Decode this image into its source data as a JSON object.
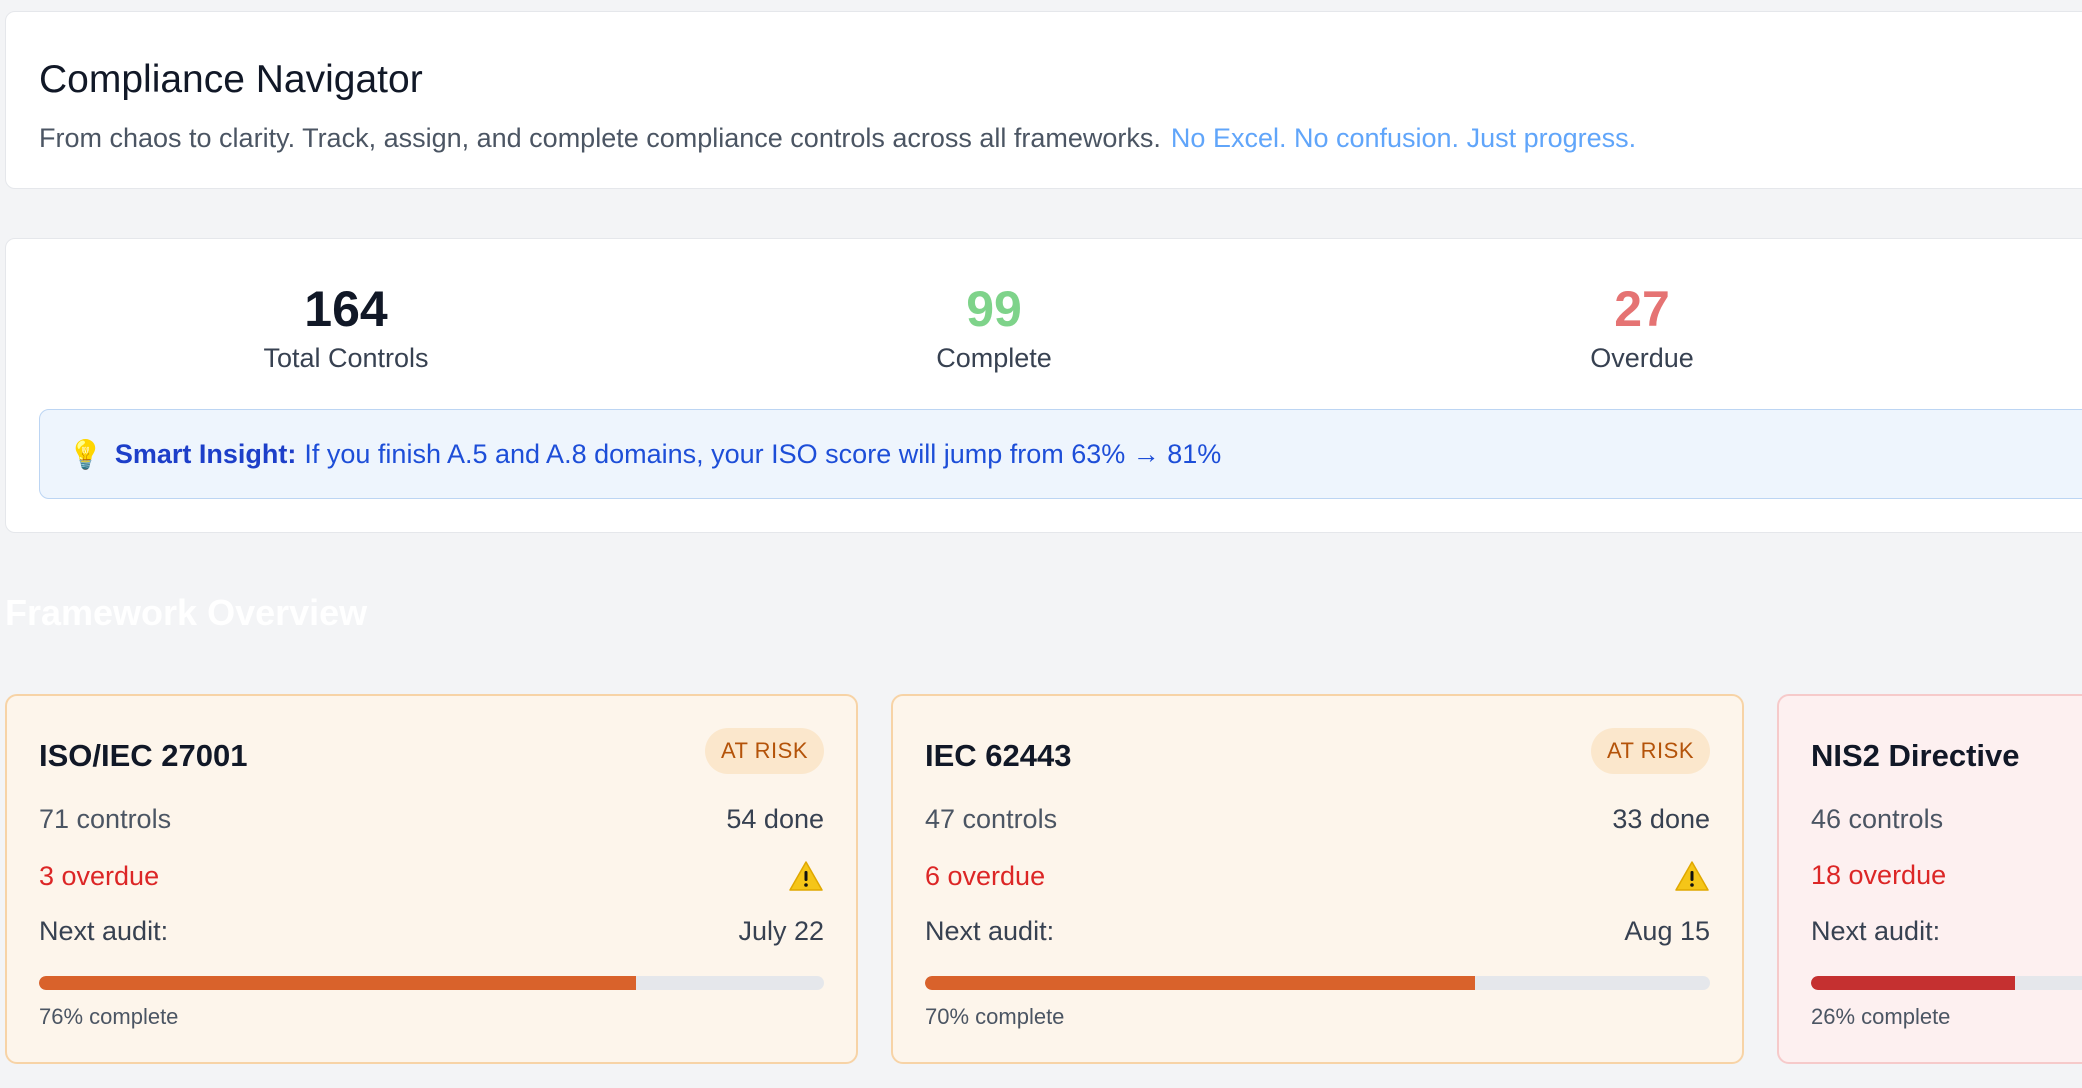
{
  "header": {
    "title": "Compliance Navigator",
    "tagline": "From chaos to clarity. Track, assign, and complete compliance controls across all frameworks.",
    "tagline_accent": "No Excel. No confusion. Just progress."
  },
  "stats": {
    "total": {
      "value": "164",
      "label": "Total Controls"
    },
    "complete": {
      "value": "99",
      "label": "Complete"
    },
    "overdue": {
      "value": "27",
      "label": "Overdue"
    }
  },
  "insight": {
    "icon": "lightbulb-icon",
    "label": "Smart Insight:",
    "text": "If you finish A.5 and A.8 domains, your ISO score will jump from 63% → 81%"
  },
  "section": {
    "title": "Framework Overview"
  },
  "frameworks": [
    {
      "name": "ISO/IEC 27001",
      "badge": "AT RISK",
      "controls": "71 controls",
      "done": "54 done",
      "overdue": "3 overdue",
      "audit_label": "Next audit:",
      "audit_date": "July 22",
      "progress": 76,
      "progress_label": "76% complete"
    },
    {
      "name": "IEC 62443",
      "badge": "AT RISK",
      "controls": "47 controls",
      "done": "33 done",
      "overdue": "6 overdue",
      "audit_label": "Next audit:",
      "audit_date": "Aug 15",
      "progress": 70,
      "progress_label": "70% complete"
    },
    {
      "name": "NIS2 Directive",
      "controls": "46 controls",
      "overdue": "18 overdue",
      "audit_label": "Next audit:",
      "progress": 26,
      "progress_label": "26% complete"
    }
  ],
  "colors": {
    "accent_blue": "#60a5fa",
    "complete_green": "#7ed38a",
    "overdue_red": "#e57373",
    "progress_orange": "#d9622b",
    "progress_red": "#c53030"
  }
}
